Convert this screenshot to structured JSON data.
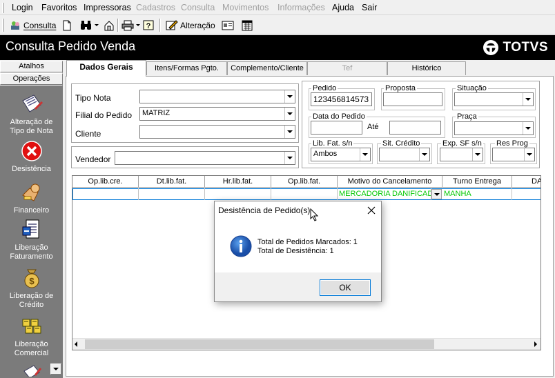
{
  "menu": {
    "items": [
      {
        "label": "Login",
        "enabled": true
      },
      {
        "label": "Favoritos",
        "enabled": true
      },
      {
        "label": "Impressoras",
        "enabled": true
      },
      {
        "label": "Cadastros",
        "enabled": false
      },
      {
        "label": "Consulta",
        "enabled": false
      },
      {
        "label": "Movimentos",
        "enabled": false
      },
      {
        "label": "Informações",
        "enabled": false
      },
      {
        "label": "Ajuda",
        "enabled": true
      },
      {
        "label": "Sair",
        "enabled": true
      }
    ]
  },
  "toolbar": {
    "consulta_label": "Consulta",
    "alteracao_label": "Alteração"
  },
  "window": {
    "title": "Consulta Pedido Venda",
    "brand": "TOTVS"
  },
  "sidebar": {
    "atalhos_label": "Atalhos",
    "operacoes_label": "Operações",
    "items": [
      {
        "line1": "Alteração de",
        "line2": "Tipo de Nota",
        "icon": "alteracao-tipo-nota-icon"
      },
      {
        "line1": "Desistência",
        "line2": "",
        "icon": "desistencia-icon"
      },
      {
        "line1": "Financeiro",
        "line2": "",
        "icon": "financeiro-icon"
      },
      {
        "line1": "Liberação",
        "line2": "Faturamento",
        "icon": "liberacao-faturamento-icon"
      },
      {
        "line1": "Liberação de",
        "line2": "Crédito",
        "icon": "liberacao-credito-icon"
      },
      {
        "line1": "Liberação",
        "line2": "Comercial",
        "icon": "liberacao-comercial-icon"
      }
    ]
  },
  "tabs": [
    {
      "label": "Dados Gerais",
      "active": true,
      "enabled": true
    },
    {
      "label": "Itens/Formas Pgto.",
      "active": false,
      "enabled": true
    },
    {
      "label": "Complemento/Cliente",
      "active": false,
      "enabled": true
    },
    {
      "label": "Tef",
      "active": false,
      "enabled": false
    },
    {
      "label": "Histórico",
      "active": false,
      "enabled": true
    }
  ],
  "form": {
    "tipo_nota_label": "Tipo Nota",
    "tipo_nota_value": "",
    "filial_label": "Filial do Pedido",
    "filial_value": "MATRIZ",
    "cliente_label": "Cliente",
    "cliente_value": "",
    "vendedor_label": "Vendedor",
    "vendedor_value": "",
    "pedido_label": "Pedido",
    "pedido_value": "123456814573",
    "proposta_label": "Proposta",
    "proposta_value": "",
    "situacao_label": "Situação",
    "situacao_value": "",
    "data_pedido_label": "Data do Pedido",
    "data_pedido_value": "",
    "ate_label": "Até",
    "ate_value": "",
    "praca_label": "Praça",
    "praca_value": "",
    "lib_fat_label": "Lib. Fat. s/n",
    "lib_fat_value": "Ambos",
    "sit_credito_label": "Sit. Crédito",
    "sit_credito_value": "",
    "exp_sf_label": "Exp. SF s/n",
    "exp_sf_value": "",
    "res_prog_label": "Res Prog",
    "res_prog_value": ""
  },
  "grid": {
    "columns": [
      "Op.lib.cre.",
      "Dt.lib.fat.",
      "Hr.lib.fat.",
      "Op.lib.fat.",
      "Motivo do Cancelamento",
      "Turno Entrega",
      "DA"
    ],
    "rows": [
      [
        "",
        "",
        "",
        "",
        "MERCADORIA DANIFICADA",
        "MANHA",
        ""
      ]
    ]
  },
  "dialog": {
    "title": "Desistência de Pedido(s)",
    "line1": "Total de Pedidos Marcados: 1",
    "line2": "Total de Desistência: 1",
    "ok_label": "OK"
  },
  "colors": {
    "title_bg": "#000000",
    "sidebar_panel": "#7b7b7b",
    "grid_text": "#00c800",
    "selection_border": "#0078d7"
  }
}
